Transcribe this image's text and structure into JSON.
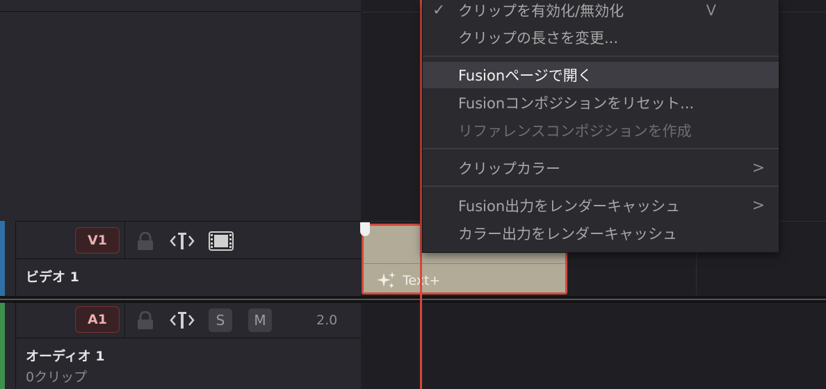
{
  "menu": {
    "items": [
      {
        "label": "クリップを有効化/無効化",
        "shortcut": "V",
        "checked": true,
        "state": "normal"
      },
      {
        "label": "クリップの長さを変更...",
        "state": "normal"
      },
      {
        "label": "Fusionページで開く",
        "state": "highlighted"
      },
      {
        "label": "Fusionコンポジションをリセット...",
        "state": "normal"
      },
      {
        "label": "リファレンスコンポジションを作成",
        "state": "disabled"
      },
      {
        "label": "クリップカラー",
        "submenu": true,
        "state": "normal"
      },
      {
        "label": "Fusion出力をレンダーキャッシュ",
        "submenu": true,
        "state": "normal"
      },
      {
        "label": "カラー出力をレンダーキャッシュ",
        "state": "normal"
      }
    ]
  },
  "tracks": {
    "video": {
      "id": "V1",
      "name": "ビデオ 1",
      "color": "#2f6fa8"
    },
    "audio": {
      "id": "A1",
      "name": "オーディオ 1",
      "sub": "0クリップ",
      "volume": "2.0",
      "solo": "S",
      "mute": "M",
      "color": "#3f8f4f"
    }
  },
  "clip": {
    "label": "Text+"
  },
  "colors": {
    "playhead": "#d9463c",
    "clip_fill": "#b1ab98",
    "clip_border": "#d14a3c"
  }
}
